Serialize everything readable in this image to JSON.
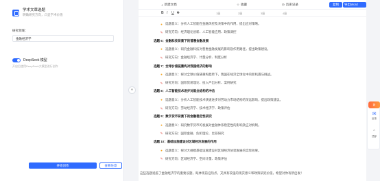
{
  "left": {
    "title": "学术文章选题",
    "subtitle": "明确研究方向，凸显学术价值",
    "field_label": "研究领域：",
    "field_value": "金融经济学",
    "deepseek_label": "DeepSeek 模型",
    "deepseek_desc": "开启后使用DeepSeek大模型进行创作",
    "start_button": "开始创作",
    "import_button": "查看任意"
  },
  "topbar": {
    "new_doc": "新建文档",
    "favorite": "收藏",
    "history": "历史记录",
    "copy": "复制",
    "export_word": "导出Word"
  },
  "toolbar": {
    "bold": "B",
    "italic": "I",
    "underline": "U",
    "strike": "S",
    "h1": "1级",
    "h2": "2级",
    "h3": "3级",
    "h4": "4级"
  },
  "content": {
    "rows": [
      {
        "type": "row",
        "icon": "bulb",
        "text": "选题意义：分析人工智能在金融风控及决策中的作用，提出应对策略。"
      },
      {
        "type": "row",
        "icon": "pin",
        "text": "研究方向：经济理论创新、人工智能应用、政策调控"
      },
      {
        "type": "section",
        "text": "选题 6：金融科技背景下的普惠金融发展"
      },
      {
        "type": "row",
        "icon": "bulb",
        "text": "选题意义：研究金融科技对普惠金融发展的影响及作用路径，提出政策建议。"
      },
      {
        "type": "row",
        "icon": "pin",
        "text": "研究方向：金融经济学、计量分析、制度分析"
      },
      {
        "type": "section",
        "text": "选题 7：全球价值链重构对我国经济的影响"
      },
      {
        "type": "row",
        "icon": "bulb",
        "text": "选题意义：探讨全球价值链重构趋势下，我国在经济全球化中的新机遇与挑战。"
      },
      {
        "type": "row",
        "icon": "pin",
        "text": "研究方向：国际贸易理论、投入产出分析、案例研究"
      },
      {
        "type": "section",
        "text": "选题 8：人工智能技术进步对就业结构的冲击"
      },
      {
        "type": "row",
        "icon": "bulb",
        "text": "选题意义：分析人工智能技术快速进步对劳动力市场结构的深远影响，提出政策建议。"
      },
      {
        "type": "row",
        "icon": "pin",
        "text": "研究方向：劳动经济学、技术经济学、政策评估"
      },
      {
        "type": "section",
        "text": "选题 9：数字货币背景下的金融稳定性研究"
      },
      {
        "type": "row",
        "icon": "bulb",
        "text": "选题意义：研究数字货币的发展对金融体系稳定性的影响及应对机制。"
      },
      {
        "type": "row",
        "icon": "pin",
        "text": "研究方向：国际金融、危机理论、比较研究"
      },
      {
        "type": "section",
        "text": "选题 10：基础设施建设对区域经济发展的作用"
      },
      {
        "type": "row",
        "icon": "bulb",
        "text": "选题意义：探讨大规模基础设施建设对区域经济协调发展的实际效果。"
      },
      {
        "type": "row",
        "icon": "pin",
        "text": "研究方向：区域经济学、空间计量、政策评估"
      }
    ],
    "bottom_note": "这些选题涵盖了金融经济学的重要议题，既体现前沿热点，又具有较强的现实意义和政策研究价值，希望对你有所启发！"
  },
  "side": {
    "badge": "新",
    "item1": "反馈",
    "item2": "顶部"
  }
}
